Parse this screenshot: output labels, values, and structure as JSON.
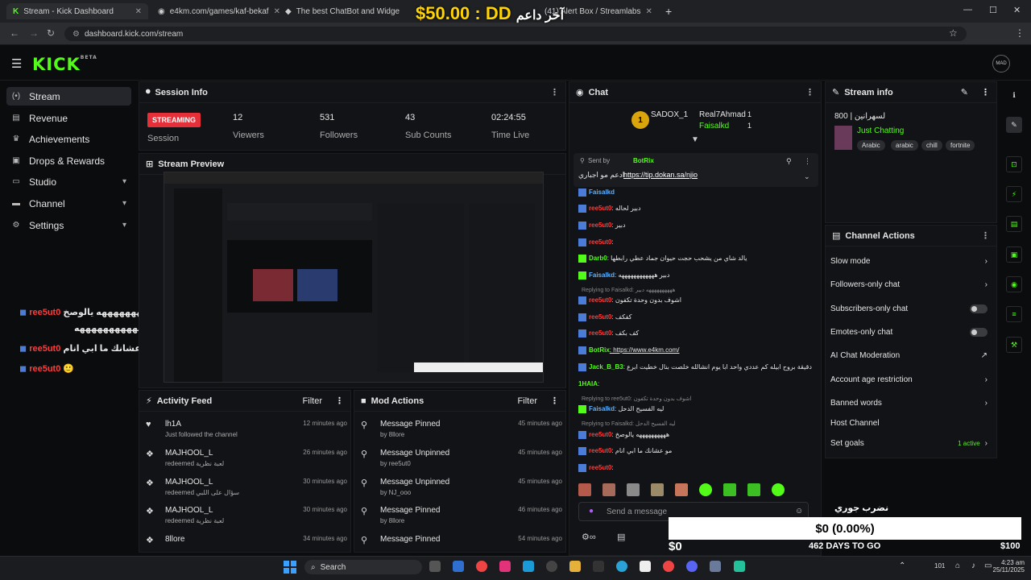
{
  "browser": {
    "tabs": [
      {
        "label": "Stream - Kick Dashboard",
        "active": true
      },
      {
        "label": "e4km.com/games/kaf-bekaf",
        "active": false
      },
      {
        "label": "The best ChatBot and Widget",
        "active": false
      },
      {
        "label": "(41) Alert Box / Streamlabs",
        "active": false
      }
    ],
    "new_tab": "+",
    "url": "dashboard.kick.com/stream",
    "window_buttons": [
      "—",
      "☐",
      "✕"
    ]
  },
  "overlay": {
    "money": "$50.00 : DD",
    "arabic": "آخر داعم",
    "chat": [
      {
        "user": "ree5ut0",
        "text": "ههههههههههههههههه يالوصخ"
      },
      {
        "user": "",
        "text": "هههههههههههههه"
      },
      {
        "user": "ree5ut0",
        "text": "مو عشانك ما ابي انام"
      },
      {
        "user": "ree5ut0",
        "text": "🙂"
      }
    ],
    "goal_text": "$0 (0.00%)",
    "goal_left": "$0",
    "goal_right": "$100",
    "goal_days": "462 DAYS TO GO",
    "goal_label": "نضرب جوري"
  },
  "header": {
    "logo": "KICK",
    "logo_sup": "BETA",
    "avatar": "MAD"
  },
  "sidebar": {
    "items": [
      {
        "label": "Stream",
        "icon": "stream-icon",
        "active": true
      },
      {
        "label": "Revenue",
        "icon": "revenue-icon"
      },
      {
        "label": "Achievements",
        "icon": "trophy-icon"
      },
      {
        "label": "Drops & Rewards",
        "icon": "gift-icon"
      },
      {
        "label": "Studio",
        "icon": "studio-icon",
        "expandable": true
      },
      {
        "label": "Channel",
        "icon": "channel-icon",
        "expandable": true
      },
      {
        "label": "Settings",
        "icon": "gear-icon",
        "expandable": true
      }
    ]
  },
  "session": {
    "title": "Session Info",
    "status": "STREAMING",
    "status_label": "Session",
    "viewers": "12",
    "viewers_label": "Viewers",
    "followers": "531",
    "followers_label": "Followers",
    "subs": "43",
    "subs_label": "Sub Counts",
    "time": "02:24:55",
    "time_label": "Time Live"
  },
  "preview": {
    "title": "Stream Preview"
  },
  "activity": {
    "title": "Activity Feed",
    "filter": "Filter",
    "rows": [
      {
        "name": "lh1A",
        "sub": "Just followed the channel",
        "time": "12 minutes ago",
        "icon": "heart-icon"
      },
      {
        "name": "MAJHOOL_L",
        "sub": "redeemed لعبة نظرية",
        "time": "26 minutes ago",
        "icon": "reward-icon"
      },
      {
        "name": "MAJHOOL_L",
        "sub": "redeemed سؤال على اللبي",
        "time": "30 minutes ago",
        "icon": "reward-icon"
      },
      {
        "name": "MAJHOOL_L",
        "sub": "redeemed لعبة نظرية",
        "time": "30 minutes ago",
        "icon": "reward-icon"
      },
      {
        "name": "8llore",
        "sub": "",
        "time": "34 minutes ago",
        "icon": "reward-icon"
      }
    ]
  },
  "mod": {
    "title": "Mod Actions",
    "filter": "Filter",
    "rows": [
      {
        "name": "Message Pinned",
        "sub": "by 8llore",
        "time": "45 minutes ago",
        "icon": "pin-icon"
      },
      {
        "name": "Message Unpinned",
        "sub": "by ree5ut0",
        "time": "45 minutes ago",
        "icon": "unpin-icon"
      },
      {
        "name": "Message Unpinned",
        "sub": "by NJ_ooo",
        "time": "45 minutes ago",
        "icon": "unpin-icon"
      },
      {
        "name": "Message Pinned",
        "sub": "by 8llore",
        "time": "46 minutes ago",
        "icon": "pin-icon"
      },
      {
        "name": "Message Pinned",
        "sub": "",
        "time": "54 minutes ago",
        "icon": "pin-icon"
      }
    ]
  },
  "chat": {
    "title": "Chat",
    "leaders": [
      {
        "name": "SADOX_1",
        "rank": "1"
      },
      {
        "name": "Real7Ahmad",
        "count": "1"
      },
      {
        "name": "Faisalkd",
        "count": "1"
      }
    ],
    "pinned_by": "Sent by",
    "pinned_user": "BotRix",
    "pinned_text": "ادعم مو اجباري",
    "pinned_link": "https://tip.dokan.sa/njio",
    "messages": [
      {
        "user": "Faisalkd",
        "text": "",
        "c": "u3"
      },
      {
        "user": "ree5ut0",
        "text": ": دبير لحاله",
        "c": "u"
      },
      {
        "user": "ree5ut0",
        "text": ": دبير",
        "c": "u"
      },
      {
        "user": "ree5ut0",
        "text": ":",
        "c": "u"
      },
      {
        "user": "Darb0",
        "text": ": يالد شاي من يشحب حجت حيوان جماد عطي رابطها",
        "c": "u2"
      },
      {
        "user": "Faisalkd",
        "text": ": دبير ههههههههههههه",
        "c": "u3"
      },
      {
        "reply": "Replying to Faisalkd: ههههههههههه دبير"
      },
      {
        "user": "ree5ut0",
        "text": ": اشوف بدون وحدة تكفون",
        "c": "u"
      },
      {
        "user": "ree5ut0",
        "text": ": كفكف",
        "c": "u"
      },
      {
        "user": "ree5ut0",
        "text": ": كف بكف",
        "c": "u"
      },
      {
        "user": "BotRix",
        "text": ": https://www.e4km.com/",
        "c": "u2"
      },
      {
        "user": "Jack_B_B3",
        "text": ": دقيقة بروح ابيله كم عددي واحد ابا يوم انشالله خلصت بنال خطيت ابرع",
        "c": "u2"
      },
      {
        "user": "1HAIA",
        "text": ":",
        "c": "u2"
      },
      {
        "reply": "Replying to ree5ut0: اشوف بدون وحدة تكفون"
      },
      {
        "user": "Faisalkd",
        "text": ": ليه الفسيح الدحل",
        "c": "u3"
      },
      {
        "reply": "Replying to Faisalkd: ليه الفسيح الدحل"
      },
      {
        "user": "ree5ut0",
        "text": ": ههههههههههه يالوصخ",
        "c": "u"
      },
      {
        "user": "ree5ut0",
        "text": ": مو عشانك ما ابي انام",
        "c": "u"
      },
      {
        "user": "ree5ut0",
        "text": ":",
        "c": "u"
      }
    ],
    "input_placeholder": "Send a message"
  },
  "stream_info": {
    "title": "Stream info",
    "stream_title": "800 | لسهرانين",
    "category": "Just Chatting",
    "tags": [
      "Arabic",
      "arabic",
      "chill",
      "fortnite"
    ]
  },
  "channel_actions": {
    "title": "Channel Actions",
    "items": [
      {
        "label": "Slow mode",
        "type": "chevron"
      },
      {
        "label": "Followers-only chat",
        "type": "chevron"
      },
      {
        "label": "Subscribers-only chat",
        "type": "toggle"
      },
      {
        "label": "Emotes-only chat",
        "type": "toggle"
      },
      {
        "label": "AI Chat Moderation",
        "type": "link"
      },
      {
        "label": "Account age restriction",
        "type": "chevron"
      },
      {
        "label": "Banned words",
        "type": "chevron"
      },
      {
        "label": "Host Channel",
        "type": "none"
      },
      {
        "label": "Set goals",
        "type": "chevron",
        "extra": "1 active"
      }
    ]
  },
  "taskbar": {
    "search": "Search",
    "time": "4:23 am",
    "date": "25/11/2025",
    "lang_sub": "101"
  }
}
